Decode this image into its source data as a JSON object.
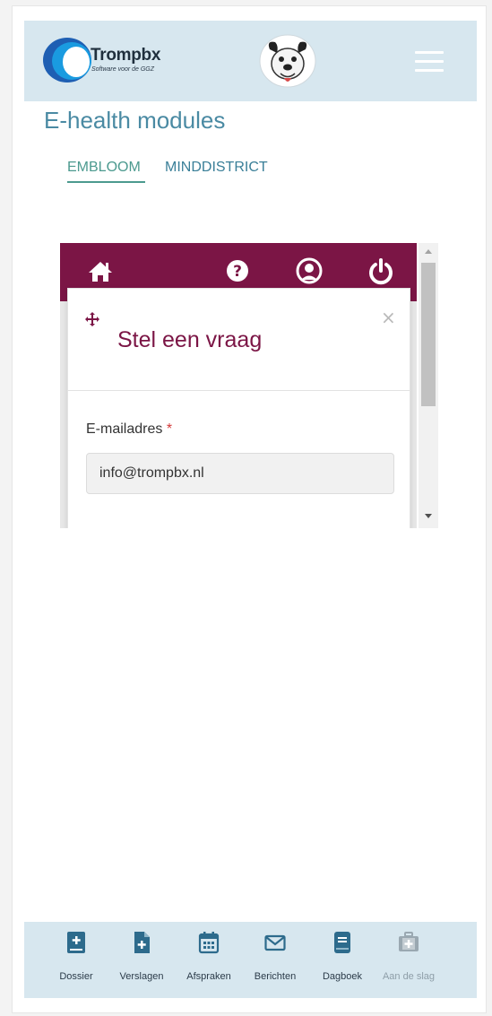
{
  "header": {
    "logo_title": "Trompbx",
    "logo_subtitle": "Software voor de GGZ",
    "mascot_icon": "dog-mascot-icon",
    "menu_icon": "hamburger-icon",
    "bg_color": "#d7e7ef"
  },
  "page": {
    "title": "E-health modules",
    "title_color": "#4a8aa3"
  },
  "tabs": [
    {
      "label": "EMBLOOM",
      "active": true
    },
    {
      "label": "MINDDISTRICT",
      "active": false
    }
  ],
  "embed": {
    "topbar_color": "#7b1545",
    "toolbar_icons": [
      "home-icon",
      "help-icon",
      "user-icon",
      "power-icon"
    ],
    "modal": {
      "title": "Stel een vraag",
      "close_glyph": "×",
      "email_label": "E-mailadres",
      "required_marker": "*",
      "email_value": "info@trompbx.nl"
    }
  },
  "bottom_nav": [
    {
      "label": "Dossier",
      "icon": "dossier-icon",
      "enabled": true
    },
    {
      "label": "Verslagen",
      "icon": "verslagen-icon",
      "enabled": true
    },
    {
      "label": "Afspraken",
      "icon": "calendar-icon",
      "enabled": true
    },
    {
      "label": "Berichten",
      "icon": "envelope-icon",
      "enabled": true
    },
    {
      "label": "Dagboek",
      "icon": "diary-icon",
      "enabled": true
    },
    {
      "label": "Aan de slag",
      "icon": "first-aid-icon",
      "enabled": false
    }
  ]
}
